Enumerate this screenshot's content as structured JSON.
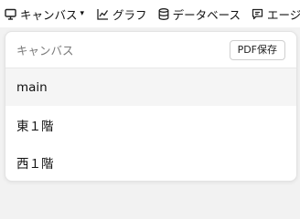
{
  "toolbar": {
    "items": [
      {
        "label": "キャンバス",
        "icon": "canvas-icon",
        "has_caret": true
      },
      {
        "label": "グラフ",
        "icon": "chart-icon"
      },
      {
        "label": "データベース",
        "icon": "database-icon"
      },
      {
        "label": "エージ",
        "icon": "chat-icon"
      }
    ],
    "caret": "▾"
  },
  "panel": {
    "title": "キャンバス",
    "pdf_button": "PDF保存",
    "items": [
      {
        "label": "main",
        "selected": true
      },
      {
        "label": "東１階"
      },
      {
        "label": "西１階"
      }
    ]
  }
}
